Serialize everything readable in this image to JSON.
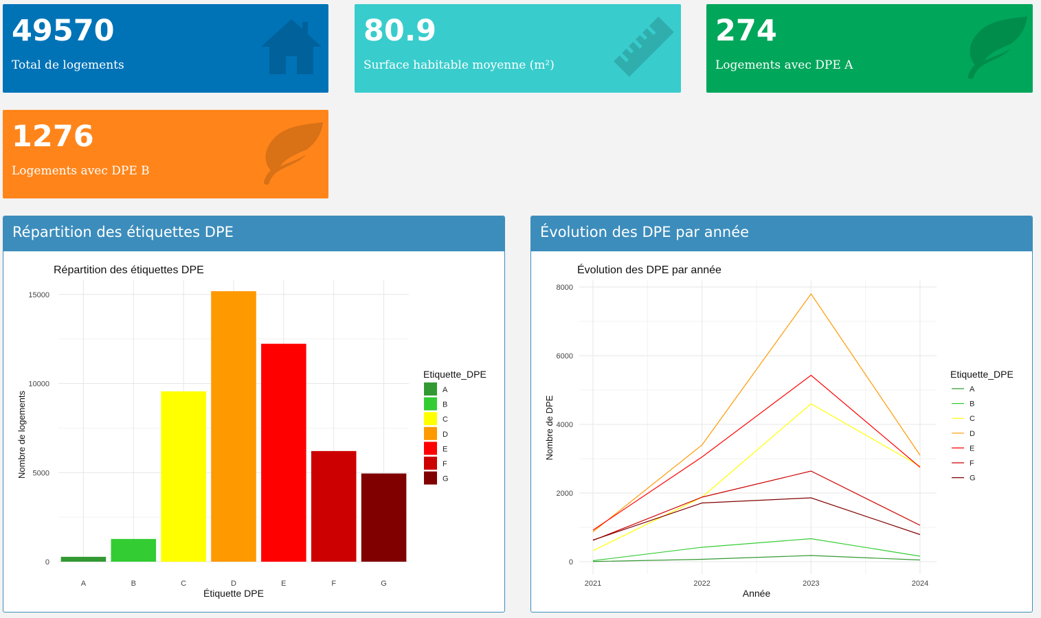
{
  "value_boxes": [
    {
      "value": "49570",
      "label": "Total de logements",
      "color": "#0073b7",
      "icon": "home-icon"
    },
    {
      "value": "80.9",
      "label": "Surface habitable moyenne (m²)",
      "color": "#39cccc",
      "icon": "ruler-icon"
    },
    {
      "value": "274",
      "label": "Logements avec DPE A",
      "color": "#00a65a",
      "icon": "leaf-icon"
    },
    {
      "value": "1276",
      "label": "Logements avec DPE B",
      "color": "#ff851b",
      "icon": "leaf-icon"
    }
  ],
  "panels": [
    {
      "title": "Répartition des étiquettes DPE"
    },
    {
      "title": "Évolution des DPE par année"
    }
  ],
  "chart_data": [
    {
      "type": "bar",
      "title": "Répartition des étiquettes DPE",
      "xlabel": "Étiquette DPE",
      "ylabel": "Nombre de logements",
      "categories": [
        "A",
        "B",
        "C",
        "D",
        "E",
        "F",
        "G"
      ],
      "values": [
        274,
        1276,
        9560,
        15180,
        12230,
        6210,
        4950
      ],
      "colors": [
        "#339933",
        "#33cc33",
        "#ffff00",
        "#ff9900",
        "#ff0000",
        "#cc0000",
        "#800000"
      ],
      "ylim": [
        0,
        15800
      ],
      "yticks": [
        0,
        5000,
        10000,
        15000
      ],
      "legend_title": "Etiquette_DPE",
      "legend_position": "right",
      "grid": true
    },
    {
      "type": "line",
      "title": "Évolution des DPE par année",
      "xlabel": "Année",
      "ylabel": "Nombre de DPE",
      "x": [
        2021,
        2022,
        2023,
        2024
      ],
      "ylim": [
        0,
        8200
      ],
      "yticks": [
        0,
        2000,
        4000,
        6000,
        8000
      ],
      "legend_title": "Etiquette_DPE",
      "legend_position": "right",
      "grid": true,
      "series": [
        {
          "name": "A",
          "color": "#339933",
          "values": [
            5,
            70,
            180,
            50
          ]
        },
        {
          "name": "B",
          "color": "#33cc33",
          "values": [
            30,
            420,
            670,
            160
          ]
        },
        {
          "name": "C",
          "color": "#ffff00",
          "values": [
            320,
            1880,
            4600,
            2780
          ]
        },
        {
          "name": "D",
          "color": "#ff9900",
          "values": [
            870,
            3400,
            7800,
            3100
          ]
        },
        {
          "name": "E",
          "color": "#ff0000",
          "values": [
            920,
            3050,
            5430,
            2750
          ]
        },
        {
          "name": "F",
          "color": "#cc0000",
          "values": [
            620,
            1880,
            2640,
            1060
          ]
        },
        {
          "name": "G",
          "color": "#800000",
          "values": [
            630,
            1710,
            1860,
            790
          ]
        }
      ]
    }
  ]
}
